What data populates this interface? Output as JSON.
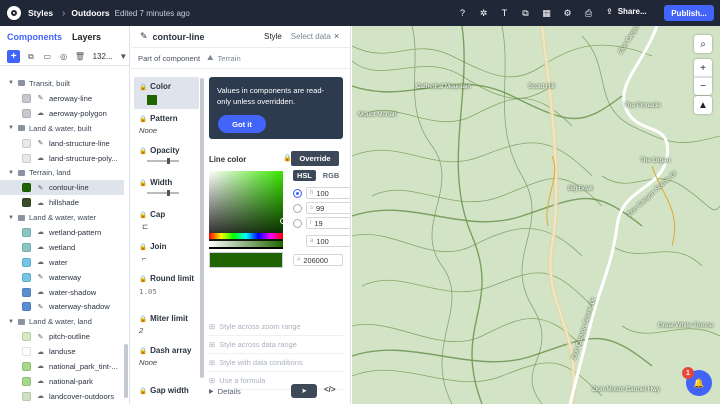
{
  "topbar": {
    "app": "Styles",
    "separator": "›",
    "style_name": "Outdoors",
    "edited": "Edited 7 minutes ago",
    "share": "Share...",
    "publish": "Publish...",
    "icons": [
      "help-icon",
      "bug-icon",
      "text-format-icon",
      "layers-icon",
      "grid-icon",
      "settings-icon",
      "print-icon"
    ]
  },
  "layers_panel": {
    "tab_components": "Components",
    "tab_layers": "Layers",
    "add": "+",
    "count": "132...",
    "rows": [
      {
        "type": "layer",
        "name": "aeroway-line",
        "color": "#c8c8d0",
        "icon": "line"
      },
      {
        "type": "layer",
        "name": "aeroway-polygon",
        "color": "#c8c8d0",
        "icon": "fill"
      },
      {
        "type": "group",
        "name": "Land & water, built"
      },
      {
        "type": "layer",
        "name": "land-structure-line",
        "color": "#e8e8e4",
        "icon": "line"
      },
      {
        "type": "layer",
        "name": "land-structure-poly...",
        "color": "#e8e8e4",
        "icon": "fill"
      },
      {
        "type": "group",
        "name": "Terrain, land"
      },
      {
        "type": "layer",
        "name": "contour-line",
        "color": "#1f6400",
        "icon": "line",
        "selected": true
      },
      {
        "type": "layer",
        "name": "hillshade",
        "color": "#3a4d24",
        "icon": "fill"
      },
      {
        "type": "group",
        "name": "Land & water, water"
      },
      {
        "type": "layer",
        "name": "wetland-pattern",
        "color": "#8ac7c2",
        "icon": "fill"
      },
      {
        "type": "layer",
        "name": "wetland",
        "color": "#8ac7c2",
        "icon": "fill"
      },
      {
        "type": "layer",
        "name": "water",
        "color": "#75c6e5",
        "icon": "fill"
      },
      {
        "type": "layer",
        "name": "waterway",
        "color": "#75c6e5",
        "icon": "line"
      },
      {
        "type": "layer",
        "name": "water-shadow",
        "color": "#5a8fd6",
        "icon": "fill"
      },
      {
        "type": "layer",
        "name": "waterway-shadow",
        "color": "#5a8fd6",
        "icon": "line"
      },
      {
        "type": "group",
        "name": "Land & water, land"
      },
      {
        "type": "layer",
        "name": "pitch-outline",
        "color": "#d6ebc0",
        "icon": "line"
      },
      {
        "type": "layer",
        "name": "landuse",
        "color": "#ffffff",
        "icon": "fill"
      },
      {
        "type": "layer",
        "name": "national_park_tint-...",
        "color": "#a8d98a",
        "icon": "fill"
      },
      {
        "type": "layer",
        "name": "national-park",
        "color": "#a8d98a",
        "icon": "fill"
      },
      {
        "type": "layer",
        "name": "landcover-outdoors",
        "color": "#cfe3c0",
        "icon": "fill"
      }
    ],
    "top_group": "Transit, built"
  },
  "component_panel": {
    "title": "contour-line",
    "tab_style": "Style",
    "tab_select": "Select data",
    "close": "×",
    "part_of": "Part of component",
    "part_name": "Terrain",
    "props": [
      {
        "label": "Color",
        "kind": "swatch",
        "color": "#1f6400"
      },
      {
        "label": "Pattern",
        "kind": "text",
        "value": "None"
      },
      {
        "label": "Opacity",
        "kind": "slider"
      },
      {
        "label": "Width",
        "kind": "slider"
      },
      {
        "label": "Cap",
        "kind": "icon",
        "value": "⊏"
      },
      {
        "label": "Join",
        "kind": "icon",
        "value": "⌐"
      },
      {
        "label": "Round limit",
        "kind": "mono",
        "value": "1.05"
      },
      {
        "label": "Miter limit",
        "kind": "text",
        "value": "2"
      },
      {
        "label": "Dash array",
        "kind": "text",
        "value": "None"
      },
      {
        "label": "Gap width",
        "kind": "none"
      }
    ],
    "tooltip": "Values in components are read-only unless overridden.",
    "got_it": "Got it",
    "line_color": "Line color",
    "override": "Override",
    "fmt_hsl": "HSL",
    "fmt_rgb": "RGB",
    "hsl": [
      {
        "k": "h",
        "v": "100"
      },
      {
        "k": "s",
        "v": "99"
      },
      {
        "k": "l",
        "v": "19"
      }
    ],
    "alpha": "100",
    "hex": "206000",
    "links": [
      "Style across zoom range",
      "Style across data range",
      "Style with data conditions",
      "Use a formula"
    ],
    "details": "Details"
  },
  "map": {
    "labels": [
      {
        "text": "Cathedral Mountain"
      },
      {
        "text": "Scout Hill"
      },
      {
        "text": "Mount Moriah"
      },
      {
        "text": "The Pinnacle"
      },
      {
        "text": "The Organ"
      },
      {
        "text": "Big Bowl"
      },
      {
        "text": "Zion Canyon Scenic Dr"
      },
      {
        "text": "Zion Canyon Scenic Dr"
      },
      {
        "text": "Zion Canyon Scenic Dr"
      },
      {
        "text": "Great White Throne"
      },
      {
        "text": "Zion-Mount Carmel Hwy"
      }
    ],
    "controls": [
      "search-icon",
      "zoom-in-icon",
      "zoom-out-icon",
      "compass-icon"
    ],
    "help_badge": "1"
  }
}
